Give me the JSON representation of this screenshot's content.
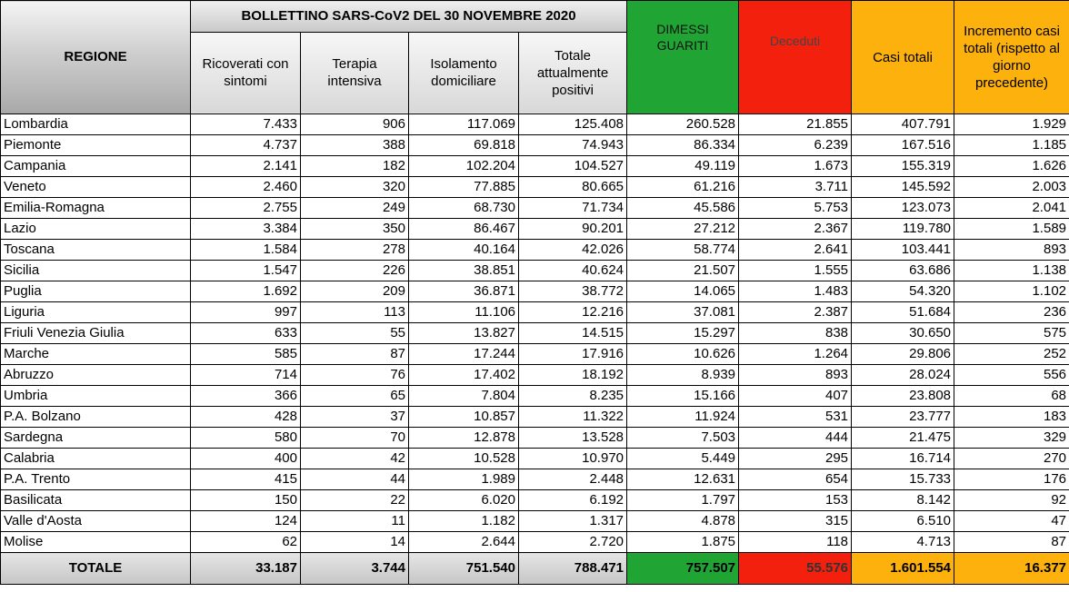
{
  "title": "BOLLETTINO SARS-CoV2 DEL 30 NOVEMBRE 2020",
  "headers": {
    "regione": "REGIONE",
    "ricoverati": "Ricoverati con sintomi",
    "terapia": "Terapia intensiva",
    "isolamento": "Isolamento domiciliare",
    "positivi": "Totale attualmente positivi",
    "dimessi": "DIMESSI GUARITI",
    "deceduti": "Deceduti",
    "casi": "Casi totali",
    "incremento": "Incremento casi totali (rispetto al giorno precedente)"
  },
  "colors": {
    "green": "#20a534",
    "red": "#f3200e",
    "orange": "#fdb10c",
    "gray": "#c9c9c9"
  },
  "rows": [
    [
      "Lombardia",
      "7.433",
      "906",
      "117.069",
      "125.408",
      "260.528",
      "21.855",
      "407.791",
      "1.929"
    ],
    [
      "Piemonte",
      "4.737",
      "388",
      "69.818",
      "74.943",
      "86.334",
      "6.239",
      "167.516",
      "1.185"
    ],
    [
      "Campania",
      "2.141",
      "182",
      "102.204",
      "104.527",
      "49.119",
      "1.673",
      "155.319",
      "1.626"
    ],
    [
      "Veneto",
      "2.460",
      "320",
      "77.885",
      "80.665",
      "61.216",
      "3.711",
      "145.592",
      "2.003"
    ],
    [
      "Emilia-Romagna",
      "2.755",
      "249",
      "68.730",
      "71.734",
      "45.586",
      "5.753",
      "123.073",
      "2.041"
    ],
    [
      "Lazio",
      "3.384",
      "350",
      "86.467",
      "90.201",
      "27.212",
      "2.367",
      "119.780",
      "1.589"
    ],
    [
      "Toscana",
      "1.584",
      "278",
      "40.164",
      "42.026",
      "58.774",
      "2.641",
      "103.441",
      "893"
    ],
    [
      "Sicilia",
      "1.547",
      "226",
      "38.851",
      "40.624",
      "21.507",
      "1.555",
      "63.686",
      "1.138"
    ],
    [
      "Puglia",
      "1.692",
      "209",
      "36.871",
      "38.772",
      "14.065",
      "1.483",
      "54.320",
      "1.102"
    ],
    [
      "Liguria",
      "997",
      "113",
      "11.106",
      "12.216",
      "37.081",
      "2.387",
      "51.684",
      "236"
    ],
    [
      "Friuli Venezia Giulia",
      "633",
      "55",
      "13.827",
      "14.515",
      "15.297",
      "838",
      "30.650",
      "575"
    ],
    [
      "Marche",
      "585",
      "87",
      "17.244",
      "17.916",
      "10.626",
      "1.264",
      "29.806",
      "252"
    ],
    [
      "Abruzzo",
      "714",
      "76",
      "17.402",
      "18.192",
      "8.939",
      "893",
      "28.024",
      "556"
    ],
    [
      "Umbria",
      "366",
      "65",
      "7.804",
      "8.235",
      "15.166",
      "407",
      "23.808",
      "68"
    ],
    [
      "P.A. Bolzano",
      "428",
      "37",
      "10.857",
      "11.322",
      "11.924",
      "531",
      "23.777",
      "183"
    ],
    [
      "Sardegna",
      "580",
      "70",
      "12.878",
      "13.528",
      "7.503",
      "444",
      "21.475",
      "329"
    ],
    [
      "Calabria",
      "400",
      "42",
      "10.528",
      "10.970",
      "5.449",
      "295",
      "16.714",
      "270"
    ],
    [
      "P.A. Trento",
      "415",
      "44",
      "1.989",
      "2.448",
      "12.631",
      "654",
      "15.733",
      "176"
    ],
    [
      "Basilicata",
      "150",
      "22",
      "6.020",
      "6.192",
      "1.797",
      "153",
      "8.142",
      "92"
    ],
    [
      "Valle d'Aosta",
      "124",
      "11",
      "1.182",
      "1.317",
      "4.878",
      "315",
      "6.510",
      "47"
    ],
    [
      "Molise",
      "62",
      "14",
      "2.644",
      "2.720",
      "1.875",
      "118",
      "4.713",
      "87"
    ]
  ],
  "totals": [
    "TOTALE",
    "33.187",
    "3.744",
    "751.540",
    "788.471",
    "757.507",
    "55.576",
    "1.601.554",
    "16.377"
  ]
}
